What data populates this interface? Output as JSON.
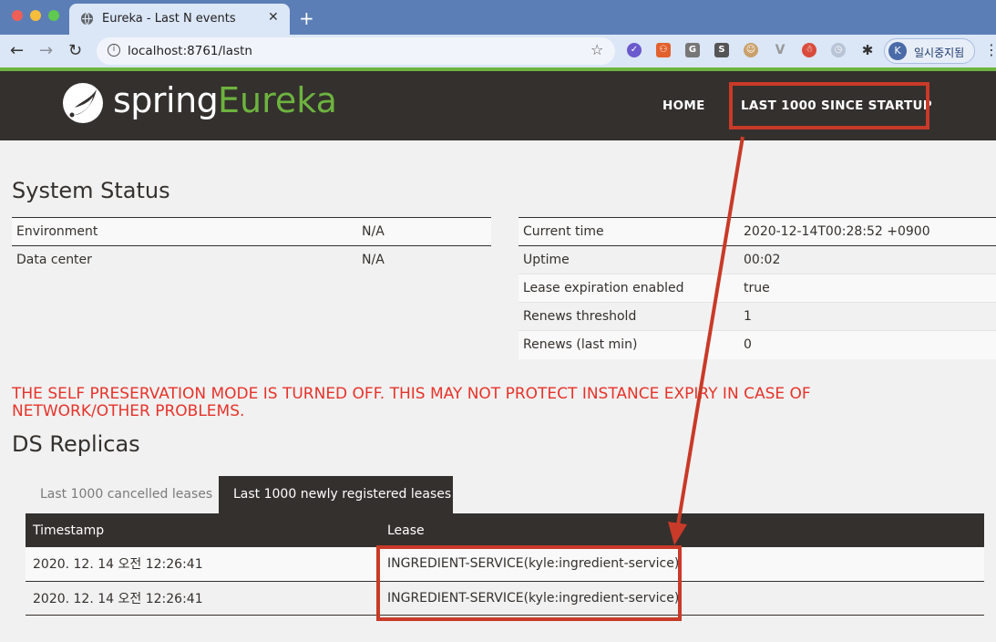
{
  "browser": {
    "tab_title": "Eureka - Last N events",
    "tab_close": "✕",
    "new_tab": "+",
    "url": "localhost:8761/lastn",
    "profile_initial": "K",
    "profile_label": "일시중지됨",
    "ext_labels": [
      "G",
      "S"
    ]
  },
  "header": {
    "logo_spring": "spring",
    "logo_eureka": "Eureka",
    "nav_home": "HOME",
    "nav_last": "LAST 1000 SINCE STARTUP"
  },
  "system_status": {
    "title": "System Status",
    "left": [
      {
        "label": "Environment",
        "value": "N/A"
      },
      {
        "label": "Data center",
        "value": "N/A"
      }
    ],
    "right": [
      {
        "label": "Current time",
        "value": "2020-12-14T00:28:52 +0900"
      },
      {
        "label": "Uptime",
        "value": "00:02"
      },
      {
        "label": "Lease expiration enabled",
        "value": "true"
      },
      {
        "label": "Renews threshold",
        "value": "1"
      },
      {
        "label": "Renews (last min)",
        "value": "0"
      }
    ]
  },
  "warning": "THE SELF PRESERVATION MODE IS TURNED OFF. THIS MAY NOT PROTECT INSTANCE EXPIRY IN CASE OF NETWORK/OTHER PROBLEMS.",
  "ds_replicas": {
    "title": "DS Replicas",
    "tabs": [
      "Last 1000 cancelled leases",
      "Last 1000 newly registered leases"
    ],
    "columns": [
      "Timestamp",
      "Lease"
    ],
    "rows": [
      {
        "timestamp": "2020. 12. 14 오전 12:26:41",
        "lease": "INGREDIENT-SERVICE(kyle:ingredient-service)"
      },
      {
        "timestamp": "2020. 12. 14 오전 12:26:41",
        "lease": "INGREDIENT-SERVICE(kyle:ingredient-service)"
      }
    ]
  },
  "colors": {
    "accent_green": "#6db33f",
    "header_dark": "#34302d",
    "warning_red": "#e6332a",
    "annotation_red": "#c93a28"
  }
}
